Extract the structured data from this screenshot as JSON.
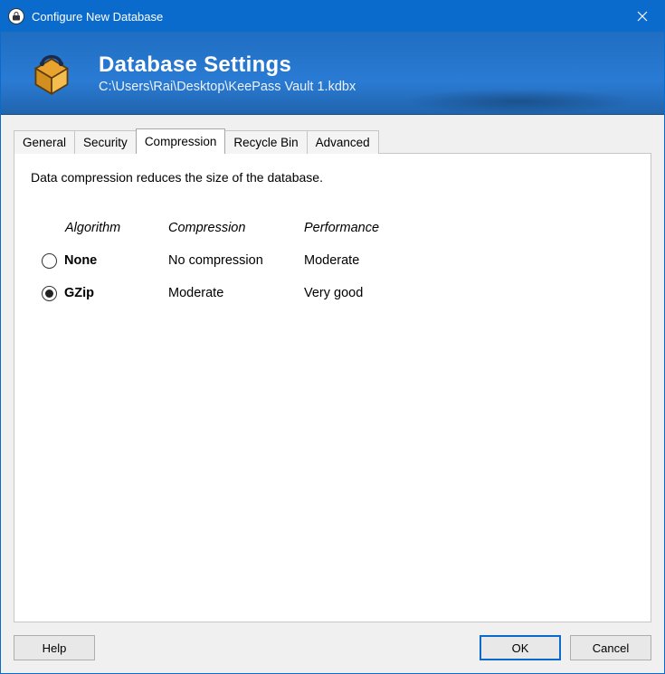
{
  "window": {
    "title": "Configure New Database"
  },
  "banner": {
    "title": "Database Settings",
    "subtitle": "C:\\Users\\Rai\\Desktop\\KeePass Vault 1.kdbx"
  },
  "tabs": [
    {
      "label": "General",
      "active": false
    },
    {
      "label": "Security",
      "active": false
    },
    {
      "label": "Compression",
      "active": true
    },
    {
      "label": "Recycle Bin",
      "active": false
    },
    {
      "label": "Advanced",
      "active": false
    }
  ],
  "compression_tab": {
    "description": "Data compression reduces the size of the database.",
    "headers": {
      "algorithm": "Algorithm",
      "compression": "Compression",
      "performance": "Performance"
    },
    "rows": [
      {
        "id": "none",
        "label": "None",
        "compression": "No compression",
        "performance": "Moderate",
        "selected": false
      },
      {
        "id": "gzip",
        "label": "GZip",
        "compression": "Moderate",
        "performance": "Very good",
        "selected": true
      }
    ]
  },
  "buttons": {
    "help": "Help",
    "ok": "OK",
    "cancel": "Cancel"
  }
}
